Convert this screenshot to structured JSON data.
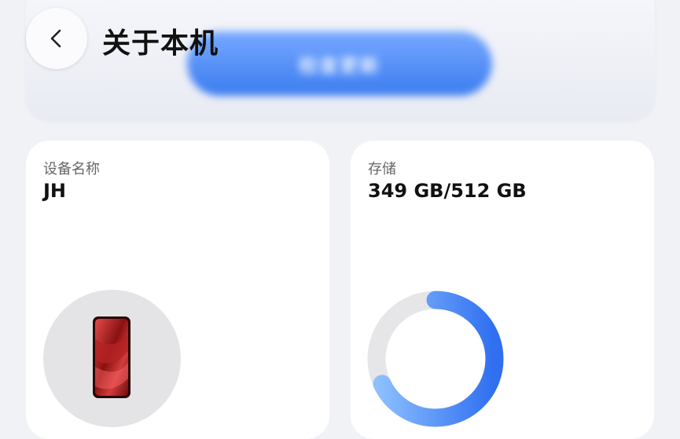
{
  "header": {
    "title": "关于本机",
    "update_button_label": "检查更新"
  },
  "device_card": {
    "label": "设备名称",
    "value": "JH",
    "image_icon": "phone-icon"
  },
  "storage_card": {
    "label": "存储",
    "value": "349 GB/512 GB",
    "used_gb": 349,
    "total_gb": 512,
    "used_fraction": 0.68
  },
  "colors": {
    "accent": "#3a7cf0",
    "ring_track": "#e6e6e8",
    "ring_start": "#8ec0ff",
    "ring_end": "#2f6ff0"
  }
}
